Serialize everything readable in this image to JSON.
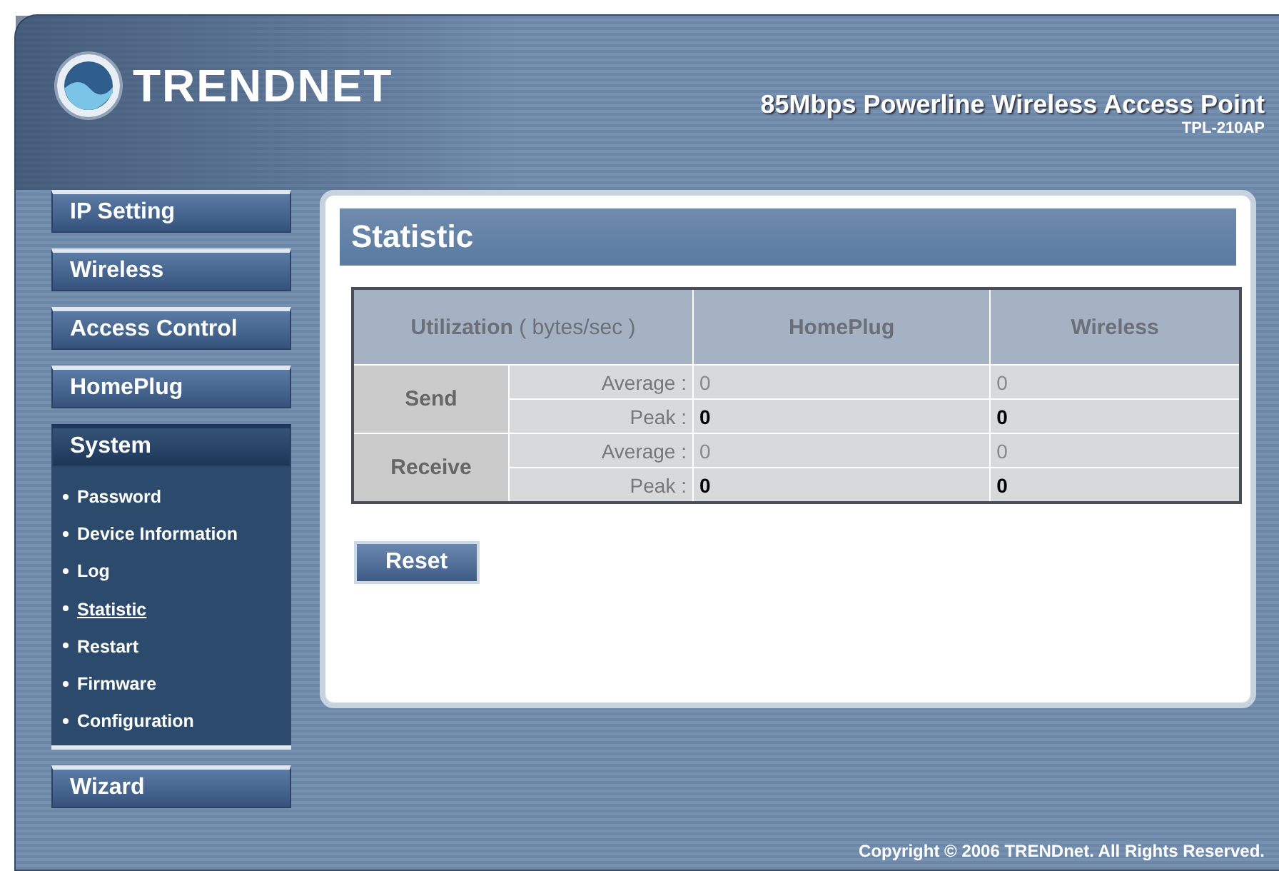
{
  "header": {
    "brand": "TRENDNET",
    "product": "85Mbps Powerline Wireless Access Point",
    "model": "TPL-210AP"
  },
  "menu": [
    {
      "label": "IP Setting",
      "selected": false
    },
    {
      "label": "Wireless",
      "selected": false
    },
    {
      "label": "Access Control",
      "selected": false
    },
    {
      "label": "HomePlug",
      "selected": false
    },
    {
      "label": "System",
      "selected": true,
      "children": [
        {
          "label": "Password",
          "selected": false
        },
        {
          "label": "Device Information",
          "selected": false
        },
        {
          "label": "Log",
          "selected": false
        },
        {
          "label": "Statistic",
          "selected": true
        },
        {
          "label": "Restart",
          "selected": false
        },
        {
          "label": "Firmware",
          "selected": false
        },
        {
          "label": "Configuration",
          "selected": false
        }
      ]
    },
    {
      "label": "Wizard",
      "selected": false
    }
  ],
  "panel": {
    "title": "Statistic",
    "table": {
      "columns": [
        "**Utilization** ( bytes/sec )",
        "HomePlug",
        "Wireless"
      ],
      "groups": [
        {
          "label": "Send",
          "rows": [
            {
              "kind": "average",
              "label": "Average :",
              "homeplug": "0",
              "wireless": "0"
            },
            {
              "kind": "peak",
              "label": "Peak :",
              "homeplug": "0",
              "wireless": "0"
            }
          ]
        },
        {
          "label": "Receive",
          "rows": [
            {
              "kind": "average",
              "label": "Average :",
              "homeplug": "0",
              "wireless": "0"
            },
            {
              "kind": "peak",
              "label": "Peak :",
              "homeplug": "0",
              "wireless": "0"
            }
          ]
        }
      ]
    },
    "button": "Reset"
  },
  "footer": "Copyright © 2006 TRENDnet. All Rights Reserved."
}
